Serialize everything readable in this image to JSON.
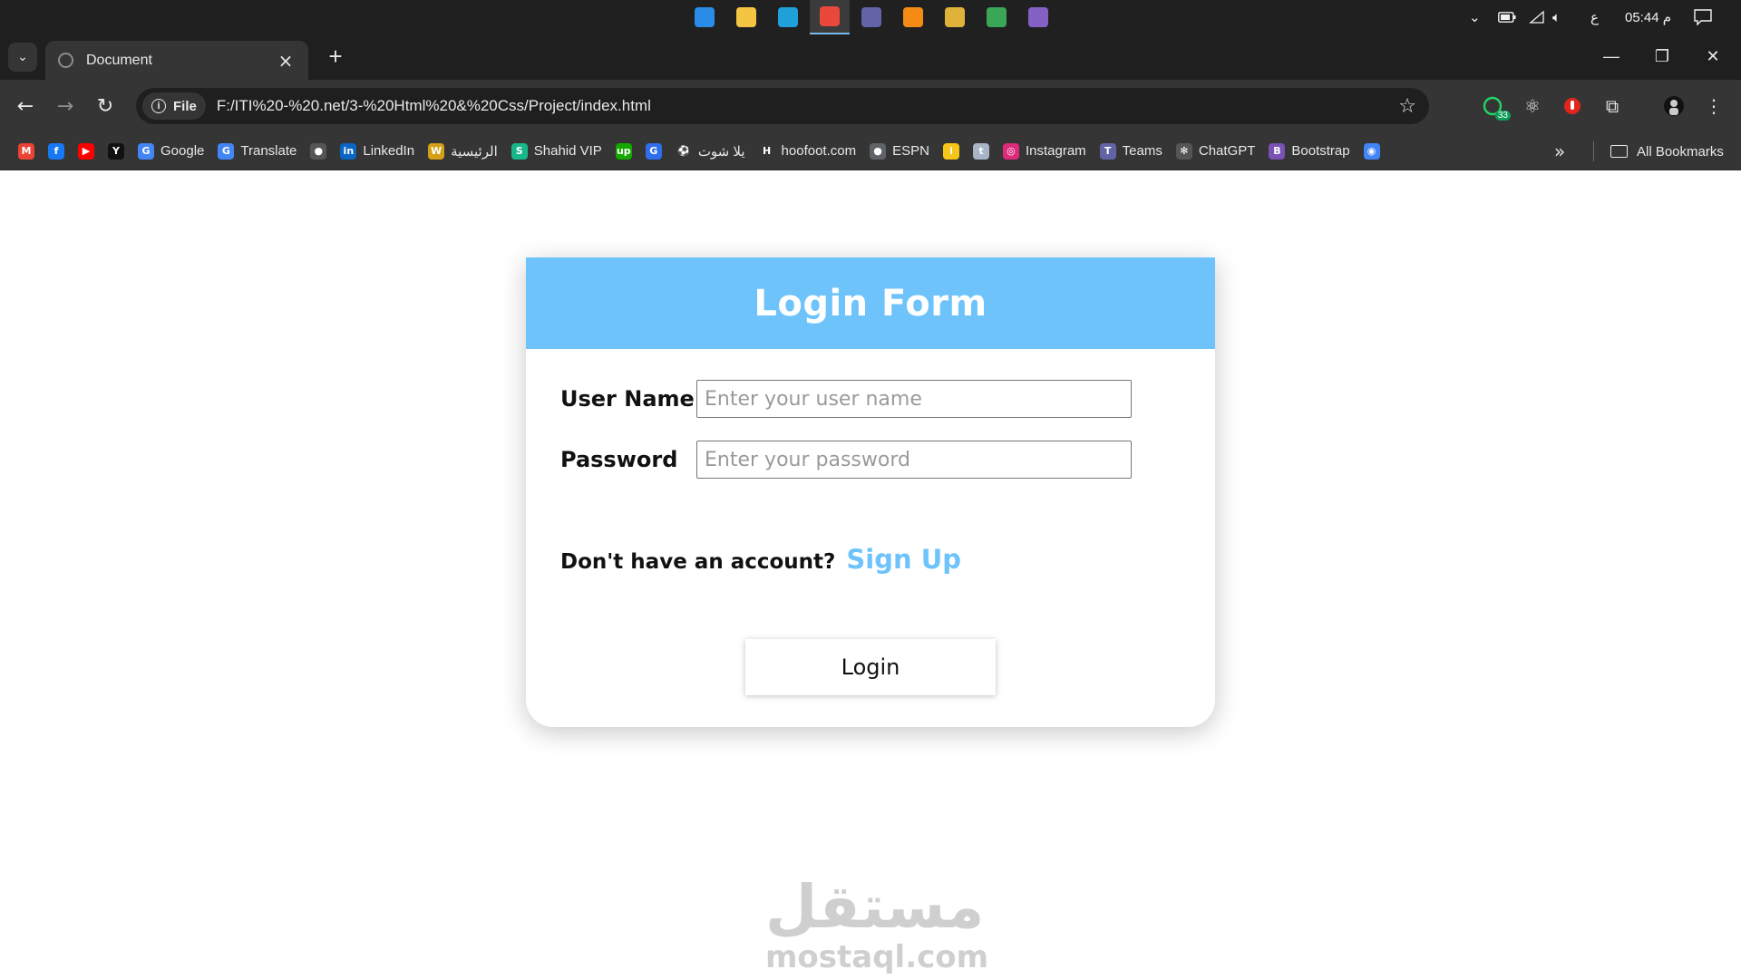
{
  "taskbar": {
    "apps": [
      {
        "name": "vscode-icon",
        "color": "#2b8ce8"
      },
      {
        "name": "file-explorer-icon",
        "color": "#f4c542"
      },
      {
        "name": "edge-icon",
        "color": "#1fa0d9"
      },
      {
        "name": "chrome-icon",
        "color": "#e9483a",
        "active": true
      },
      {
        "name": "teams-icon",
        "color": "#6264a7"
      },
      {
        "name": "vlc-icon",
        "color": "#f58b14"
      },
      {
        "name": "paint-icon",
        "color": "#e1b23a"
      },
      {
        "name": "photos-icon",
        "color": "#3aa757"
      },
      {
        "name": "visual-studio-icon",
        "color": "#8661c5"
      }
    ],
    "time": "05:44 م",
    "keyboard_lang": "ع"
  },
  "browser": {
    "tab_title": "Document",
    "address": {
      "chip": "File",
      "url": "F:/ITI%20-%20.net/3-%20Html%20&%20Css/Project/index.html"
    },
    "extension_badge": "33",
    "bookmarks": [
      {
        "label": "",
        "icon": "gmail-icon",
        "color": "#ea4335",
        "glyph": "M"
      },
      {
        "label": "",
        "icon": "facebook-icon",
        "color": "#1877f2",
        "glyph": "f"
      },
      {
        "label": "",
        "icon": "youtube-icon",
        "color": "#ff0000",
        "glyph": "▶"
      },
      {
        "label": "",
        "icon": "yts-icon",
        "color": "#111111",
        "glyph": "Y"
      },
      {
        "label": "Google",
        "icon": "google-icon",
        "color": "#4285f4",
        "glyph": "G"
      },
      {
        "label": "Translate",
        "icon": "translate-icon",
        "color": "#4285f4",
        "glyph": "G"
      },
      {
        "label": "",
        "icon": "github-icon",
        "color": "#555555",
        "glyph": "●"
      },
      {
        "label": "LinkedIn",
        "icon": "linkedin-icon",
        "color": "#0a66c2",
        "glyph": "in"
      },
      {
        "label": "الرئيسية",
        "icon": "wuzzuf-icon",
        "color": "#d4a017",
        "glyph": "W"
      },
      {
        "label": "Shahid VIP",
        "icon": "shahid-icon",
        "color": "#18b68b",
        "glyph": "S"
      },
      {
        "label": "",
        "icon": "upwork-icon",
        "color": "#14a800",
        "glyph": "up"
      },
      {
        "label": "",
        "icon": "goodreads-icon",
        "color": "#2f6fed",
        "glyph": "G"
      },
      {
        "label": "يلا شوت",
        "icon": "yallashoot-icon",
        "color": "#353535",
        "glyph": "⚽"
      },
      {
        "label": "hoofoot.com",
        "icon": "hoofoot-icon",
        "color": "#353535",
        "glyph": "H"
      },
      {
        "label": "ESPN",
        "icon": "espn-icon",
        "color": "#5f6368",
        "glyph": "●"
      },
      {
        "label": "",
        "icon": "imdb-icon",
        "color": "#f5c518",
        "glyph": "i"
      },
      {
        "label": "",
        "icon": "tumblr-icon",
        "color": "#a9b4c6",
        "glyph": "t"
      },
      {
        "label": "Instagram",
        "icon": "instagram-icon",
        "color": "#dd2a7b",
        "glyph": "◎"
      },
      {
        "label": "Teams",
        "icon": "teams-bookmark-icon",
        "color": "#6264a7",
        "glyph": "T"
      },
      {
        "label": "ChatGPT",
        "icon": "chatgpt-icon",
        "color": "#555555",
        "glyph": "✻"
      },
      {
        "label": "Bootstrap",
        "icon": "bootstrap-icon",
        "color": "#7952b3",
        "glyph": "B"
      },
      {
        "label": "",
        "icon": "chromium-icon",
        "color": "#4285f4",
        "glyph": "◉"
      }
    ],
    "all_bookmarks": "All Bookmarks"
  },
  "page": {
    "form_title": "Login Form",
    "username": {
      "label": "User Name",
      "placeholder": "Enter your user name",
      "value": ""
    },
    "password": {
      "label": "Password",
      "placeholder": "Enter your password",
      "value": ""
    },
    "signup_prompt": "Don't have an account?",
    "signup_link": "Sign Up",
    "login_button": "Login",
    "accent_color": "#6ec3fb"
  },
  "watermark": {
    "arabic": "مستقل",
    "latin": "mostaql.com"
  }
}
